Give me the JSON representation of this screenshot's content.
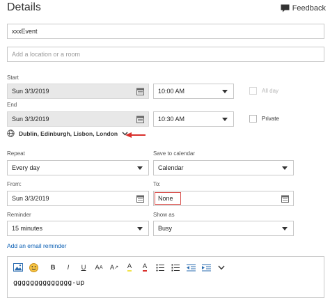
{
  "header": {
    "title": "Details",
    "feedback": "Feedback"
  },
  "event": {
    "title_value": "xxxEvent",
    "location_placeholder": "Add a location or a room"
  },
  "start": {
    "label": "Start",
    "date": "Sun 3/3/2019",
    "time": "10:00 AM",
    "all_day_label": "All day"
  },
  "end": {
    "label": "End",
    "date": "Sun 3/3/2019",
    "time": "10:30 AM",
    "private_label": "Private"
  },
  "timezone": {
    "value": "Dublin, Edinburgh, Lisbon, London"
  },
  "repeat": {
    "label": "Repeat",
    "value": "Every day"
  },
  "save_to": {
    "label": "Save to calendar",
    "value": "Calendar"
  },
  "from": {
    "label": "From:",
    "value": "Sun 3/3/2019"
  },
  "to": {
    "label": "To:",
    "value": "None"
  },
  "reminder": {
    "label": "Reminder",
    "value": "15 minutes"
  },
  "show_as": {
    "label": "Show as",
    "value": "Busy"
  },
  "email_reminder": {
    "label": "Add an email reminder"
  },
  "toolbar": {
    "bold": "B",
    "italic": "I",
    "underline": "U",
    "font_size": "A",
    "grow": "A",
    "shrink": "A",
    "color": "A"
  },
  "body": {
    "text": "gggggggggggggg-up"
  },
  "colors": {
    "accent_link": "#0a5fb4",
    "annotation_arrow": "#d9302c",
    "highlight_box": "#d9534f"
  }
}
